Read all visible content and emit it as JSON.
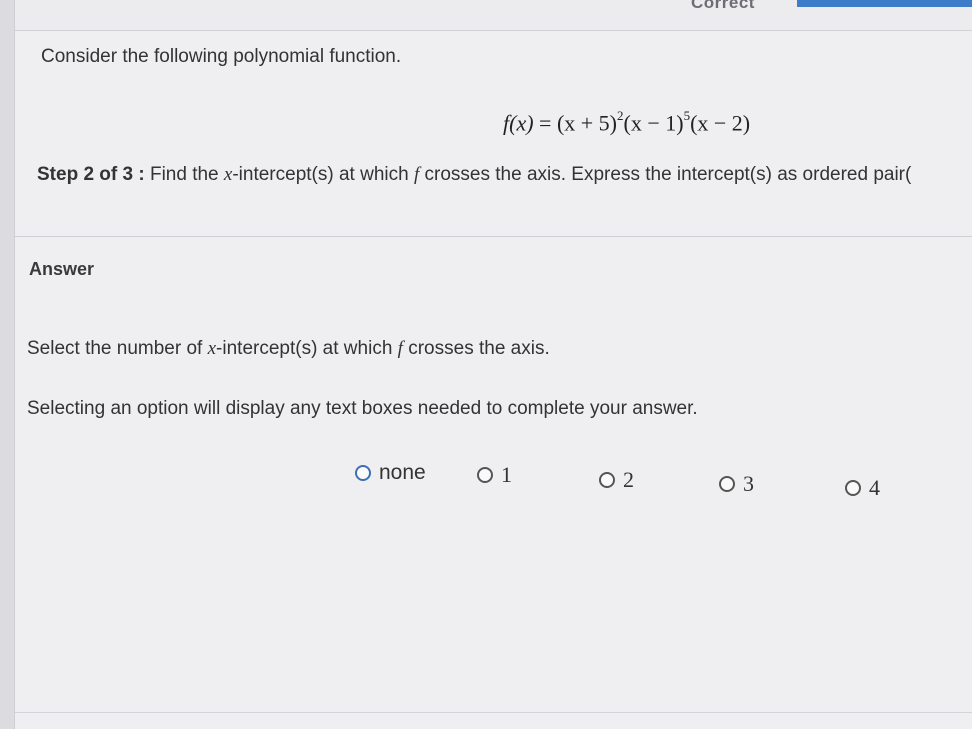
{
  "header": {
    "status_label": "Correct"
  },
  "question": {
    "intro": "Consider the following polynomial function.",
    "formula": {
      "lhs": "f(x)",
      "equals": "=",
      "factor1_base": "(x + 5)",
      "factor1_exp": "2",
      "factor2_base": "(x − 1)",
      "factor2_exp": "5",
      "factor3": "(x − 2)"
    },
    "step_label": "Step 2 of 3 :",
    "step_text_1": "Find the ",
    "step_var": "x",
    "step_text_2": "-intercept(s) at which ",
    "step_func": "f",
    "step_text_3": " crosses the axis. Express the intercept(s) as ordered pair("
  },
  "answer": {
    "heading": "Answer",
    "prompt_1": "Select the number of ",
    "prompt_var": "x",
    "prompt_2": "-intercept(s) at which ",
    "prompt_func": "f",
    "prompt_3": " crosses the axis.",
    "hint": "Selecting an option will display any text boxes needed to complete your answer.",
    "options": [
      {
        "label": "none"
      },
      {
        "label": "1"
      },
      {
        "label": "2"
      },
      {
        "label": "3"
      },
      {
        "label": "4"
      }
    ],
    "accent_color": "#3d6fb5"
  }
}
